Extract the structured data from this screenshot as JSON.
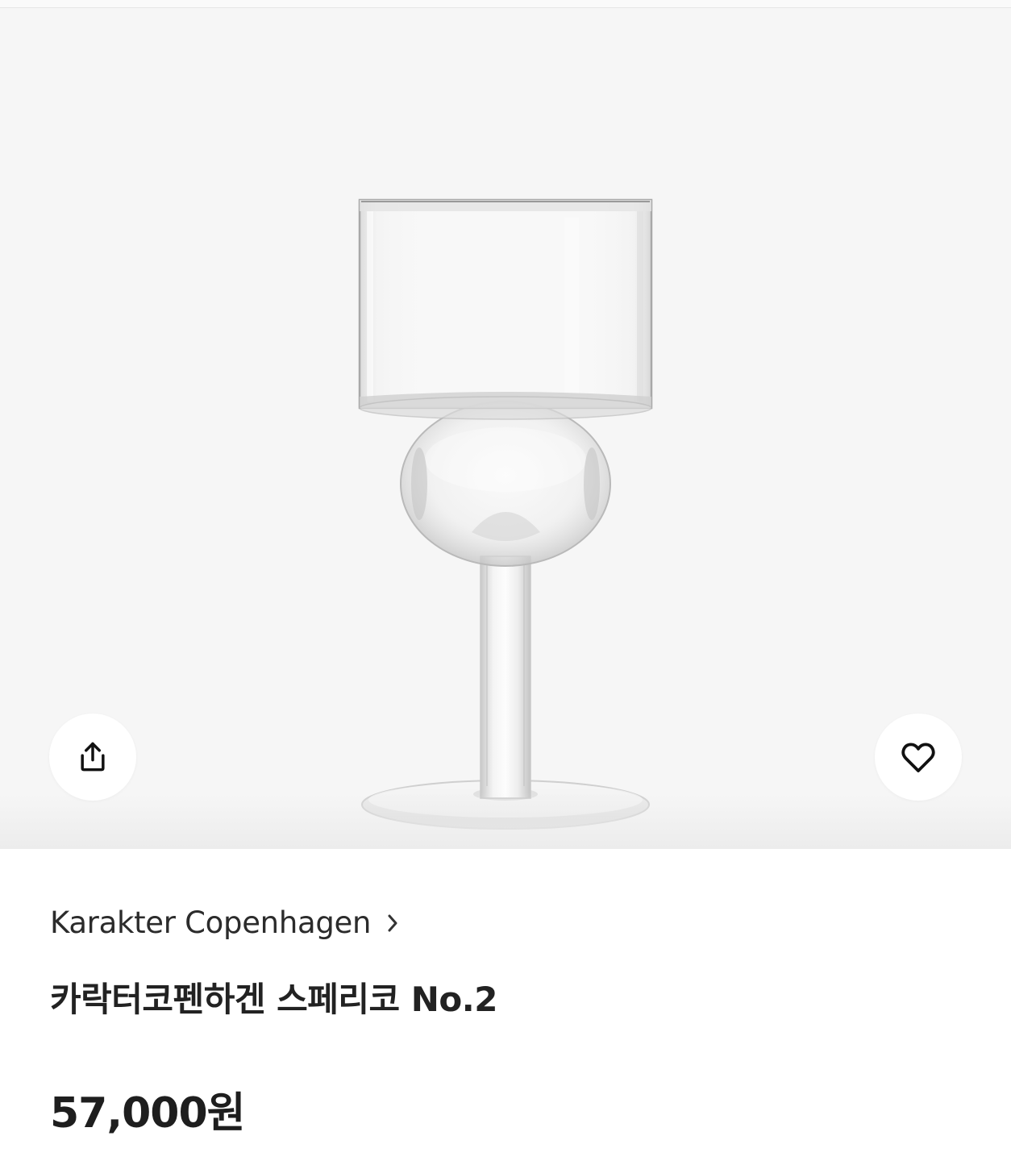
{
  "gallery": {
    "image_alt": "Karakter Copenhagen Sferico No.2 glass",
    "share_icon": "share-icon",
    "like_icon": "heart-icon"
  },
  "product": {
    "brand": "Karakter Copenhagen",
    "title": "카락터코펜하겐 스페리코 No.2",
    "price": "57,000원"
  },
  "colors": {
    "gallery_background": "#f6f6f6",
    "text_primary": "#222222",
    "text_brand": "#2b2b2b"
  }
}
